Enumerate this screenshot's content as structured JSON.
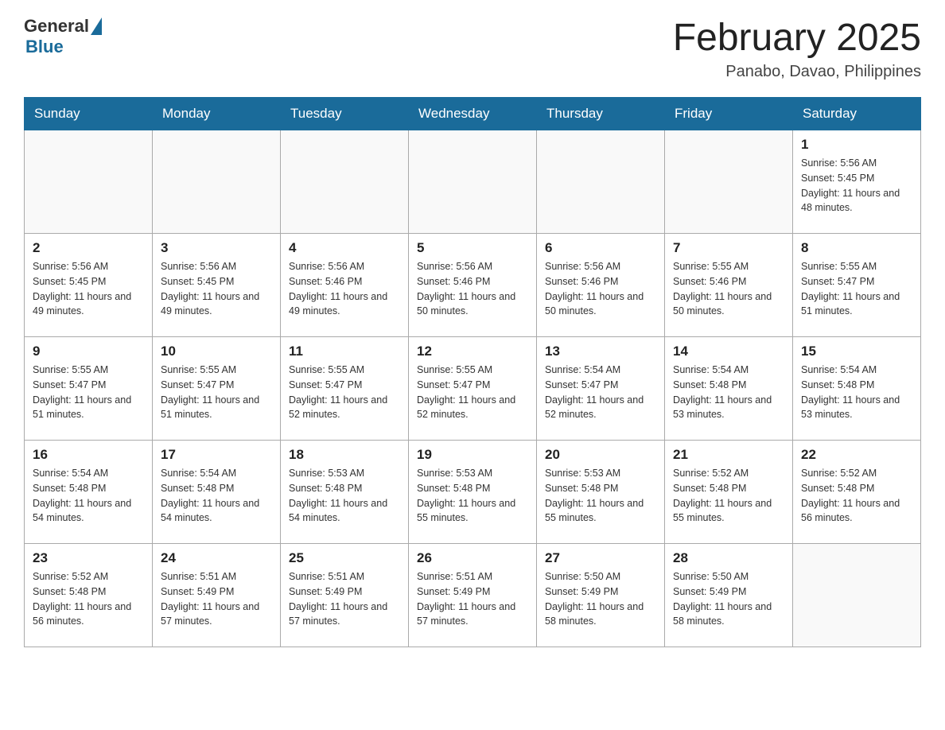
{
  "header": {
    "logo_general": "General",
    "logo_blue": "Blue",
    "title": "February 2025",
    "subtitle": "Panabo, Davao, Philippines"
  },
  "weekdays": [
    "Sunday",
    "Monday",
    "Tuesday",
    "Wednesday",
    "Thursday",
    "Friday",
    "Saturday"
  ],
  "weeks": [
    [
      {
        "day": "",
        "sunrise": "",
        "sunset": "",
        "daylight": ""
      },
      {
        "day": "",
        "sunrise": "",
        "sunset": "",
        "daylight": ""
      },
      {
        "day": "",
        "sunrise": "",
        "sunset": "",
        "daylight": ""
      },
      {
        "day": "",
        "sunrise": "",
        "sunset": "",
        "daylight": ""
      },
      {
        "day": "",
        "sunrise": "",
        "sunset": "",
        "daylight": ""
      },
      {
        "day": "",
        "sunrise": "",
        "sunset": "",
        "daylight": ""
      },
      {
        "day": "1",
        "sunrise": "Sunrise: 5:56 AM",
        "sunset": "Sunset: 5:45 PM",
        "daylight": "Daylight: 11 hours and 48 minutes."
      }
    ],
    [
      {
        "day": "2",
        "sunrise": "Sunrise: 5:56 AM",
        "sunset": "Sunset: 5:45 PM",
        "daylight": "Daylight: 11 hours and 49 minutes."
      },
      {
        "day": "3",
        "sunrise": "Sunrise: 5:56 AM",
        "sunset": "Sunset: 5:45 PM",
        "daylight": "Daylight: 11 hours and 49 minutes."
      },
      {
        "day": "4",
        "sunrise": "Sunrise: 5:56 AM",
        "sunset": "Sunset: 5:46 PM",
        "daylight": "Daylight: 11 hours and 49 minutes."
      },
      {
        "day": "5",
        "sunrise": "Sunrise: 5:56 AM",
        "sunset": "Sunset: 5:46 PM",
        "daylight": "Daylight: 11 hours and 50 minutes."
      },
      {
        "day": "6",
        "sunrise": "Sunrise: 5:56 AM",
        "sunset": "Sunset: 5:46 PM",
        "daylight": "Daylight: 11 hours and 50 minutes."
      },
      {
        "day": "7",
        "sunrise": "Sunrise: 5:55 AM",
        "sunset": "Sunset: 5:46 PM",
        "daylight": "Daylight: 11 hours and 50 minutes."
      },
      {
        "day": "8",
        "sunrise": "Sunrise: 5:55 AM",
        "sunset": "Sunset: 5:47 PM",
        "daylight": "Daylight: 11 hours and 51 minutes."
      }
    ],
    [
      {
        "day": "9",
        "sunrise": "Sunrise: 5:55 AM",
        "sunset": "Sunset: 5:47 PM",
        "daylight": "Daylight: 11 hours and 51 minutes."
      },
      {
        "day": "10",
        "sunrise": "Sunrise: 5:55 AM",
        "sunset": "Sunset: 5:47 PM",
        "daylight": "Daylight: 11 hours and 51 minutes."
      },
      {
        "day": "11",
        "sunrise": "Sunrise: 5:55 AM",
        "sunset": "Sunset: 5:47 PM",
        "daylight": "Daylight: 11 hours and 52 minutes."
      },
      {
        "day": "12",
        "sunrise": "Sunrise: 5:55 AM",
        "sunset": "Sunset: 5:47 PM",
        "daylight": "Daylight: 11 hours and 52 minutes."
      },
      {
        "day": "13",
        "sunrise": "Sunrise: 5:54 AM",
        "sunset": "Sunset: 5:47 PM",
        "daylight": "Daylight: 11 hours and 52 minutes."
      },
      {
        "day": "14",
        "sunrise": "Sunrise: 5:54 AM",
        "sunset": "Sunset: 5:48 PM",
        "daylight": "Daylight: 11 hours and 53 minutes."
      },
      {
        "day": "15",
        "sunrise": "Sunrise: 5:54 AM",
        "sunset": "Sunset: 5:48 PM",
        "daylight": "Daylight: 11 hours and 53 minutes."
      }
    ],
    [
      {
        "day": "16",
        "sunrise": "Sunrise: 5:54 AM",
        "sunset": "Sunset: 5:48 PM",
        "daylight": "Daylight: 11 hours and 54 minutes."
      },
      {
        "day": "17",
        "sunrise": "Sunrise: 5:54 AM",
        "sunset": "Sunset: 5:48 PM",
        "daylight": "Daylight: 11 hours and 54 minutes."
      },
      {
        "day": "18",
        "sunrise": "Sunrise: 5:53 AM",
        "sunset": "Sunset: 5:48 PM",
        "daylight": "Daylight: 11 hours and 54 minutes."
      },
      {
        "day": "19",
        "sunrise": "Sunrise: 5:53 AM",
        "sunset": "Sunset: 5:48 PM",
        "daylight": "Daylight: 11 hours and 55 minutes."
      },
      {
        "day": "20",
        "sunrise": "Sunrise: 5:53 AM",
        "sunset": "Sunset: 5:48 PM",
        "daylight": "Daylight: 11 hours and 55 minutes."
      },
      {
        "day": "21",
        "sunrise": "Sunrise: 5:52 AM",
        "sunset": "Sunset: 5:48 PM",
        "daylight": "Daylight: 11 hours and 55 minutes."
      },
      {
        "day": "22",
        "sunrise": "Sunrise: 5:52 AM",
        "sunset": "Sunset: 5:48 PM",
        "daylight": "Daylight: 11 hours and 56 minutes."
      }
    ],
    [
      {
        "day": "23",
        "sunrise": "Sunrise: 5:52 AM",
        "sunset": "Sunset: 5:48 PM",
        "daylight": "Daylight: 11 hours and 56 minutes."
      },
      {
        "day": "24",
        "sunrise": "Sunrise: 5:51 AM",
        "sunset": "Sunset: 5:49 PM",
        "daylight": "Daylight: 11 hours and 57 minutes."
      },
      {
        "day": "25",
        "sunrise": "Sunrise: 5:51 AM",
        "sunset": "Sunset: 5:49 PM",
        "daylight": "Daylight: 11 hours and 57 minutes."
      },
      {
        "day": "26",
        "sunrise": "Sunrise: 5:51 AM",
        "sunset": "Sunset: 5:49 PM",
        "daylight": "Daylight: 11 hours and 57 minutes."
      },
      {
        "day": "27",
        "sunrise": "Sunrise: 5:50 AM",
        "sunset": "Sunset: 5:49 PM",
        "daylight": "Daylight: 11 hours and 58 minutes."
      },
      {
        "day": "28",
        "sunrise": "Sunrise: 5:50 AM",
        "sunset": "Sunset: 5:49 PM",
        "daylight": "Daylight: 11 hours and 58 minutes."
      },
      {
        "day": "",
        "sunrise": "",
        "sunset": "",
        "daylight": ""
      }
    ]
  ]
}
